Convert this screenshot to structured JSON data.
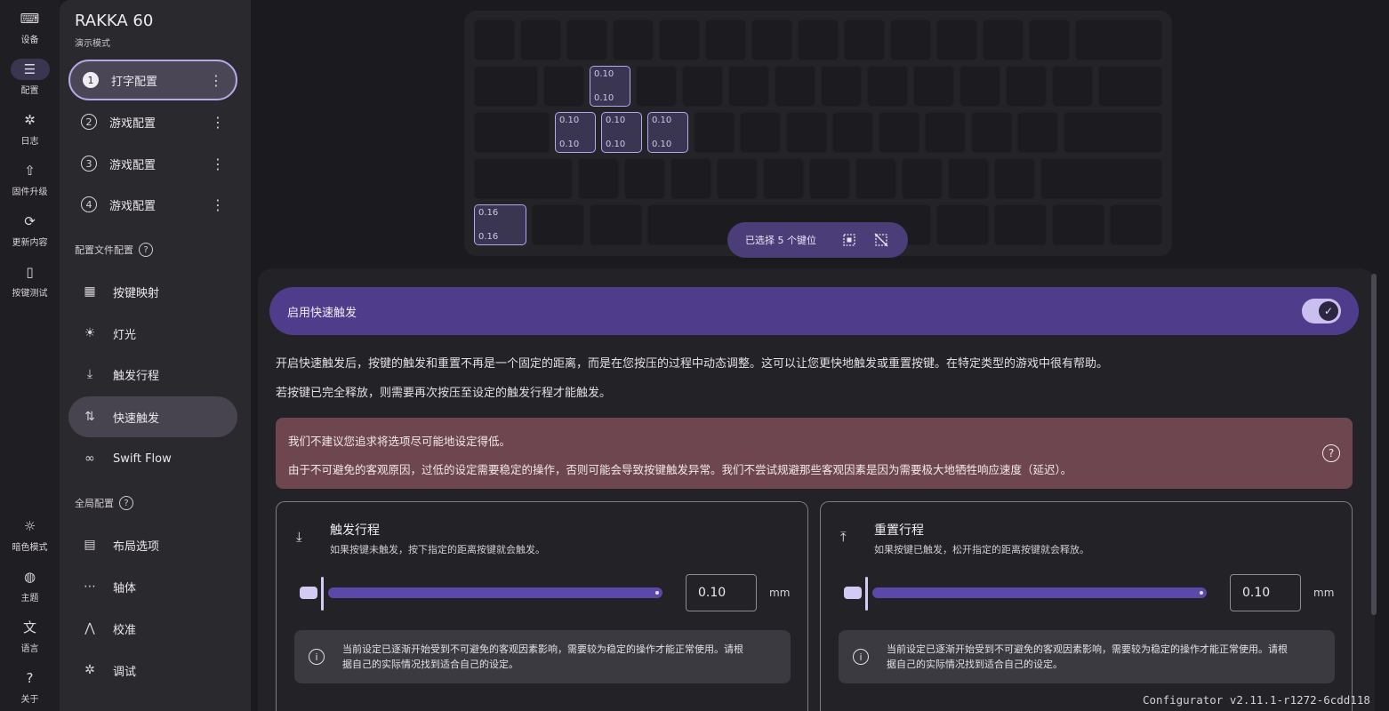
{
  "rail": [
    {
      "icon": "keyboard-icon",
      "glyph": "⌨",
      "label": "设备"
    },
    {
      "icon": "sliders-icon",
      "glyph": "☰",
      "label": "配置",
      "active": true
    },
    {
      "icon": "bug-icon",
      "glyph": "✲",
      "label": "日志"
    },
    {
      "icon": "upload-icon",
      "glyph": "⇧",
      "label": "固件升级"
    },
    {
      "icon": "update-icon",
      "glyph": "⟳",
      "label": "更新内容"
    },
    {
      "icon": "key-test-icon",
      "glyph": "▯",
      "label": "按键测试"
    }
  ],
  "rail_bottom": [
    {
      "icon": "brightness-icon",
      "glyph": "☼",
      "label": "暗色模式"
    },
    {
      "icon": "palette-icon",
      "glyph": "◍",
      "label": "主题"
    },
    {
      "icon": "translate-icon",
      "glyph": "文",
      "label": "语言"
    },
    {
      "icon": "help-icon",
      "glyph": "?",
      "label": "关于"
    }
  ],
  "device": {
    "name": "RAKKA 60",
    "mode": "演示模式"
  },
  "profiles": [
    {
      "num": "1",
      "label": "打字配置",
      "active": true
    },
    {
      "num": "2",
      "label": "游戏配置"
    },
    {
      "num": "3",
      "label": "游戏配置"
    },
    {
      "num": "4",
      "label": "游戏配置"
    }
  ],
  "profile_section": {
    "label": "配置文件配置",
    "help": "?"
  },
  "profile_nav": [
    {
      "icon": "keymap-icon",
      "glyph": "▦",
      "label": "按键映射"
    },
    {
      "icon": "light-icon",
      "glyph": "☀",
      "label": "灯光"
    },
    {
      "icon": "actuation-icon",
      "glyph": "⤓",
      "label": "触发行程"
    },
    {
      "icon": "rapid-trigger-icon",
      "glyph": "⇅",
      "label": "快速触发",
      "active": true
    },
    {
      "icon": "swift-flow-icon",
      "glyph": "∞",
      "label": "Swift Flow"
    }
  ],
  "global_section": {
    "label": "全局配置",
    "help": "?"
  },
  "global_nav": [
    {
      "icon": "layout-icon",
      "glyph": "▤",
      "label": "布局选项"
    },
    {
      "icon": "switch-icon",
      "glyph": "⋯",
      "label": "轴体"
    },
    {
      "icon": "calibrate-icon",
      "glyph": "⋀",
      "label": "校准"
    },
    {
      "icon": "debug-icon",
      "glyph": "✲",
      "label": "调试"
    }
  ],
  "keyboard": {
    "selected_keys": [
      {
        "top": "0.10",
        "bottom": "0.10"
      },
      {
        "top": "0.10",
        "bottom": "0.10"
      },
      {
        "top": "0.10",
        "bottom": "0.10"
      },
      {
        "top": "0.10",
        "bottom": "0.10"
      },
      {
        "top": "0.16",
        "bottom": "0.16"
      }
    ]
  },
  "selection": {
    "text": "已选择 5 个键位"
  },
  "rapid_trigger": {
    "title": "启用快速触发",
    "enabled": true,
    "desc1": "开启快速触发后，按键的触发和重置不再是一个固定的距离，而是在您按压的过程中动态调整。这可以让您更快地触发或重置按键。在特定类型的游戏中很有帮助。",
    "desc2": "若按键已完全释放，则需要再次按压至设定的触发行程才能触发。",
    "warning1": "我们不建议您追求将选项尽可能地设定得低。",
    "warning2": "由于不可避免的客观原因，过低的设定需要稳定的操作，否则可能会导致按键触发异常。我们不尝试规避那些客观因素是因为需要极大地牺牲响应速度（延迟）。"
  },
  "cards": [
    {
      "title": "触发行程",
      "sub": "如果按键未触发，按下指定的距离按键就会触发。",
      "value": "0.10",
      "unit": "mm",
      "info_line1": "当前设定已逐渐开始受到不可避免的客观因素影响，需要较为稳定的操作才能正常使用。请根",
      "info_line2": "据自己的实际情况找到适合自己的设定。",
      "slider_fraction": 0.0
    },
    {
      "title": "重置行程",
      "sub": "如果按键已触发，松开指定的距离按键就会释放。",
      "value": "0.10",
      "unit": "mm",
      "info_line1": "当前设定已逐渐开始受到不可避免的客观因素影响，需要较为稳定的操作才能正常使用。请根",
      "info_line2": "据自己的实际情况找到适合自己的设定。",
      "slider_fraction": 0.0
    }
  ],
  "version": "Configurator v2.11.1-r1272-6cdd118"
}
